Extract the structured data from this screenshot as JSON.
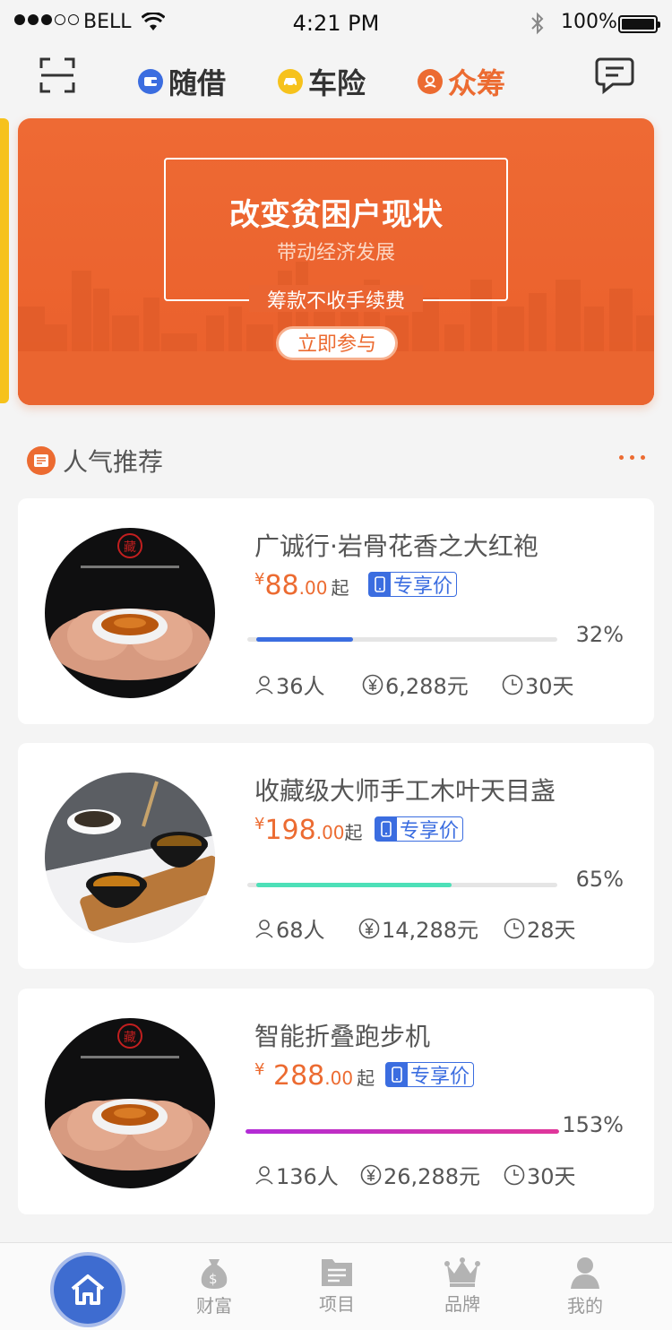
{
  "status_bar": {
    "carrier": "BELL",
    "time": "4:21 PM",
    "battery": "100%"
  },
  "top_nav": {
    "tabs": [
      {
        "label": "随借",
        "icon": "wallet-icon",
        "color": "#3b6de0"
      },
      {
        "label": "车险",
        "icon": "car-icon",
        "color": "#f6c21c"
      },
      {
        "label": "众筹",
        "icon": "crowdfund-icon",
        "color": "#ec6b31"
      }
    ],
    "active_tab": "众筹"
  },
  "banner": {
    "title": "改变贫困户现状",
    "subtitle": "带动经济发展",
    "fee_note": "筹款不收手续费",
    "cta": "立即参与"
  },
  "section": {
    "title": "人气推荐"
  },
  "products": [
    {
      "title": "广诚行·岩骨花香之大红袍",
      "price_yen": "¥",
      "price_int": "88",
      "price_dec": ".00",
      "price_suffix": "起",
      "badge": "专享价",
      "progress": 0.32,
      "progress_label": "32%",
      "progress_color": "#3b6de0",
      "backers": "36人",
      "amount": "6,288元",
      "days": "30天"
    },
    {
      "title": "收藏级大师手工木叶天目盏",
      "price_yen": "¥",
      "price_int": "198",
      "price_dec": ".00",
      "price_suffix": "起",
      "badge": "专享价",
      "progress": 0.65,
      "progress_label": "65%",
      "progress_color": "#4de0b8",
      "backers": "68人",
      "amount": "14,288元",
      "days": "28天"
    },
    {
      "title": "智能折叠跑步机",
      "price_yen": "¥",
      "price_int": " 288",
      "price_dec": ".00",
      "price_suffix": "起",
      "badge": "专享价",
      "progress": 1.53,
      "progress_label": "153%",
      "progress_color": "#b22bd6",
      "backers": "136人",
      "amount": "26,288元",
      "days": "30天"
    }
  ],
  "tab_bar": {
    "items": [
      {
        "label": "财富",
        "icon": "money-bag-icon"
      },
      {
        "label": "项目",
        "icon": "project-list-icon"
      },
      {
        "label": "品牌",
        "icon": "crown-icon"
      },
      {
        "label": "我的",
        "icon": "user-icon"
      }
    ],
    "home_icon": "home-icon"
  }
}
